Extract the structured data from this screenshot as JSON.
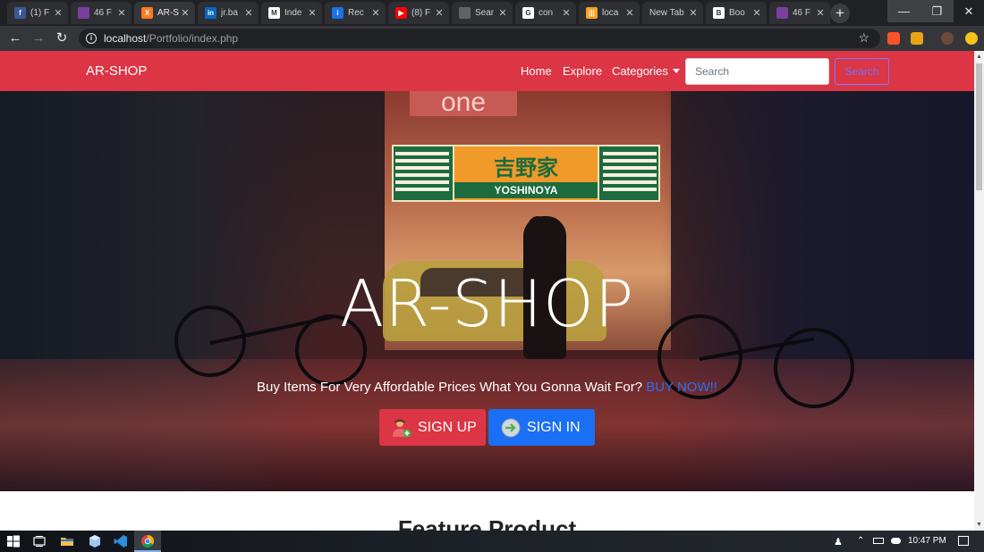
{
  "browser": {
    "tabs": [
      {
        "label": "(1) F",
        "favicon": "facebook-icon",
        "color": "#3b5998",
        "glyph": "f"
      },
      {
        "label": "46 F",
        "favicon": "purple-site-icon",
        "color": "#7b3fa0",
        "glyph": ""
      },
      {
        "label": "AR-S",
        "favicon": "xampp-icon",
        "color": "#fb7a24",
        "glyph": "X",
        "active": true
      },
      {
        "label": "jr.ba",
        "favicon": "linkedin-icon",
        "color": "#0a66c2",
        "glyph": "in"
      },
      {
        "label": "Inde",
        "favicon": "gmail-icon",
        "color": "#ffffff",
        "glyph": "M"
      },
      {
        "label": "Rec",
        "favicon": "info-icon",
        "color": "#1a73e8",
        "glyph": "i"
      },
      {
        "label": "(8) F",
        "favicon": "youtube-icon",
        "color": "#ff0000",
        "glyph": "▶"
      },
      {
        "label": "Sear",
        "favicon": "globe-icon",
        "color": "#5f6368",
        "glyph": ""
      },
      {
        "label": "con",
        "favicon": "google-icon",
        "color": "#ffffff",
        "glyph": "G"
      },
      {
        "label": "loca",
        "favicon": "xampp-chart-icon",
        "color": "#f7a41d",
        "glyph": "|||"
      },
      {
        "label": "New Tab",
        "favicon": "",
        "color": "",
        "glyph": ""
      },
      {
        "label": "Boo",
        "favicon": "bootstrap-icon",
        "color": "#ffffff",
        "glyph": "B"
      },
      {
        "label": "46 F",
        "favicon": "purple-site-icon",
        "color": "#7b3fa0",
        "glyph": ""
      }
    ],
    "url_host": "localhost",
    "url_path": "/Portfolio/index.php"
  },
  "navbar": {
    "brand": "AR-SHOP",
    "links": [
      "Home",
      "Explore",
      "Categories"
    ],
    "search_placeholder": "Search",
    "search_button": "Search"
  },
  "hero": {
    "title": "AR-SHOP",
    "tagline": "Buy Items For Very Affordable Prices What You Gonna Wait For?",
    "tagline_link": "BUY NOW!!",
    "signup_label": "SIGN UP",
    "signin_label": "SIGN IN",
    "sign_japanese": "吉野家",
    "sign_english": "YOSHINOYA",
    "sign_top": "one"
  },
  "feature": {
    "title": "Feature Product"
  },
  "taskbar": {
    "time": "10:47 PM"
  },
  "colors": {
    "navbar": "#dc3545",
    "signin": "#1a6ff5",
    "buy_now": "#2f6df5"
  }
}
